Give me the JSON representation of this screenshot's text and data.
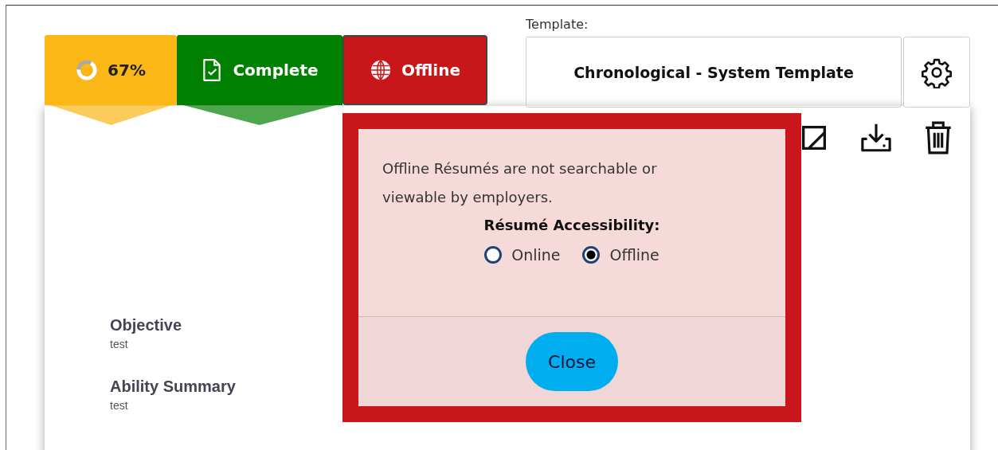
{
  "tabs": [
    {
      "kind": "progress",
      "label": "67%",
      "level": 0.67,
      "color": "#fbb715",
      "selected": false
    },
    {
      "kind": "status",
      "label": "Complete",
      "color": "#008000",
      "selected": false
    },
    {
      "kind": "accessibility",
      "label": "Offline",
      "color": "#c8161a",
      "selected": true
    }
  ],
  "template": {
    "label": "Template:",
    "value": "Chronological - System Template"
  },
  "sections": [
    {
      "heading": "Objective",
      "text": "test"
    },
    {
      "heading": "Ability Summary",
      "text": "test"
    }
  ],
  "popover": {
    "message": "Offline Résumés are not searchable or viewable by employers.",
    "heading": "Résumé Accessibility:",
    "options": [
      {
        "label": "Online",
        "selected": false
      },
      {
        "label": "Offline",
        "selected": true
      }
    ],
    "button": "Close"
  }
}
